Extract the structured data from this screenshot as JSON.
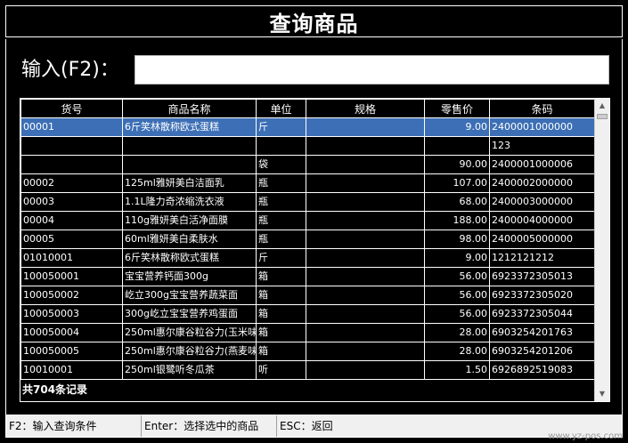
{
  "window": {
    "title": "查询商品"
  },
  "search": {
    "label": "输入(F2)：",
    "value": "",
    "placeholder": ""
  },
  "table": {
    "columns": [
      "货号",
      "商品名称",
      "单位",
      "规格",
      "零售价",
      "条码"
    ],
    "rows": [
      [
        "00001",
        "6斤笑林散称欧式蛋糕",
        "斤",
        "",
        "9.00",
        "2400001000000"
      ],
      [
        "",
        "",
        "",
        "",
        "",
        "123"
      ],
      [
        "",
        "",
        "袋",
        "",
        "90.00",
        "2400001000006"
      ],
      [
        "00002",
        "125ml雅妍美白洁面乳",
        "瓶",
        "",
        "107.00",
        "2400002000000"
      ],
      [
        "00003",
        "1.1L隆力奇浓缩洗衣液",
        "瓶",
        "",
        "68.00",
        "2400003000000"
      ],
      [
        "00004",
        "110g雅妍美白活净面膜",
        "瓶",
        "",
        "188.00",
        "2400004000000"
      ],
      [
        "00005",
        "60ml雅妍美白柔肤水",
        "瓶",
        "",
        "98.00",
        "2400005000000"
      ],
      [
        "01010001",
        "6斤笑林散称欧式蛋糕",
        "斤",
        "",
        "9.00",
        "1212121212"
      ],
      [
        "100050001",
        "宝宝营养钙面300g",
        "箱",
        "",
        "56.00",
        "6923372305013"
      ],
      [
        "100050002",
        "屹立300g宝宝营养蔬菜面",
        "箱",
        "",
        "56.00",
        "6923372305020"
      ],
      [
        "100050003",
        "300g屹立宝宝营养鸡蛋面",
        "箱",
        "",
        "56.00",
        "6923372305044"
      ],
      [
        "100050004",
        "250ml惠尔康谷粒谷力(玉米味",
        "箱",
        "",
        "28.00",
        "6903254201763"
      ],
      [
        "100050005",
        "250ml惠尔康谷粒谷力(燕麦味",
        "箱",
        "",
        "28.00",
        "6903254201206"
      ],
      [
        "10010001",
        "250ml银鹭听冬瓜茶",
        "听",
        "",
        "1.50",
        "6926892519083"
      ]
    ],
    "selected_row": 0,
    "footer": "共704条记录"
  },
  "status_bar": {
    "f2": "F2：输入查询条件",
    "enter": "Enter：选择选中的商品",
    "esc": "ESC：返回",
    "watermark": "www.yz-pos.com"
  },
  "colors": {
    "background": "#000000",
    "selection": "#3c6fb5",
    "text": "#ffffff"
  }
}
